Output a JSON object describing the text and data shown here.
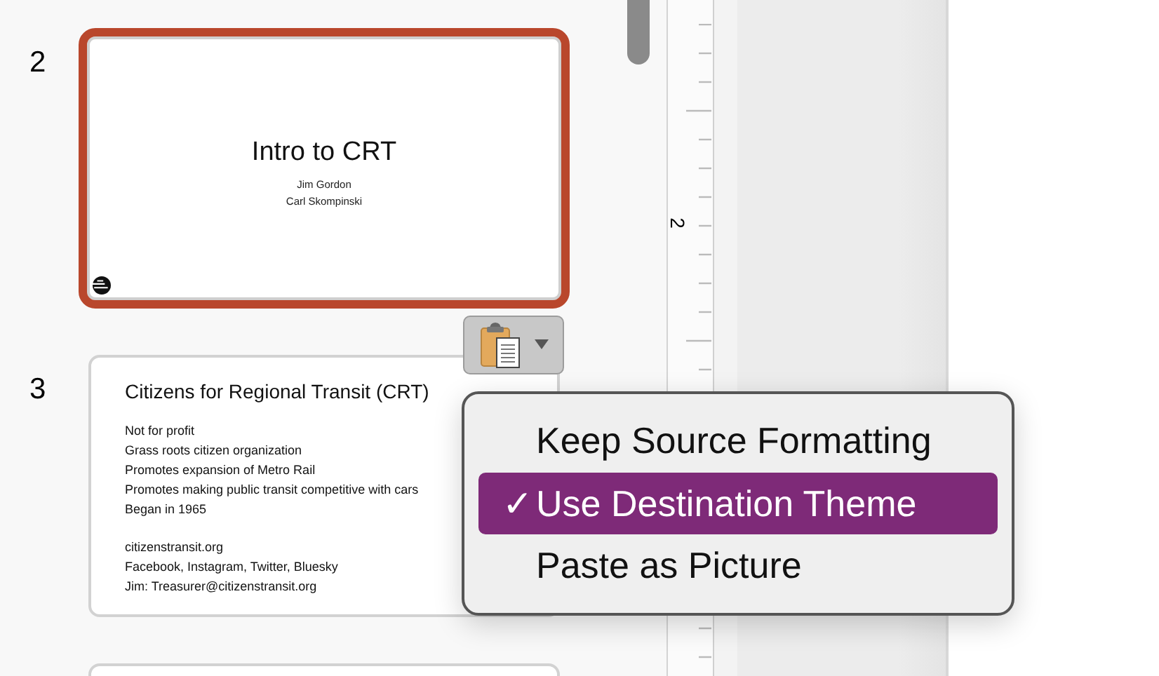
{
  "slides": [
    {
      "number": "2",
      "selected": true,
      "title": "Intro to CRT",
      "subtitle_lines": [
        "Jim Gordon",
        "Carl Skompinski"
      ]
    },
    {
      "number": "3",
      "selected": false,
      "title": "Citizens for Regional Transit (CRT)",
      "body_groups": [
        [
          "Not for profit",
          "Grass roots citizen organization",
          "Promotes expansion of Metro Rail",
          "Promotes making public transit competitive with cars",
          "Began in 1965"
        ],
        [
          "citizenstransit.org",
          "Facebook, Instagram, Twitter, Bluesky",
          "Jim: Treasurer@citizenstransit.org"
        ]
      ]
    }
  ],
  "ruler": {
    "label": "2"
  },
  "paste_menu": {
    "check_mark": "✓",
    "items": [
      {
        "label": "Keep Source Formatting",
        "selected": false
      },
      {
        "label": "Use Destination Theme",
        "selected": true
      },
      {
        "label": "Paste as Picture",
        "selected": false
      }
    ]
  }
}
